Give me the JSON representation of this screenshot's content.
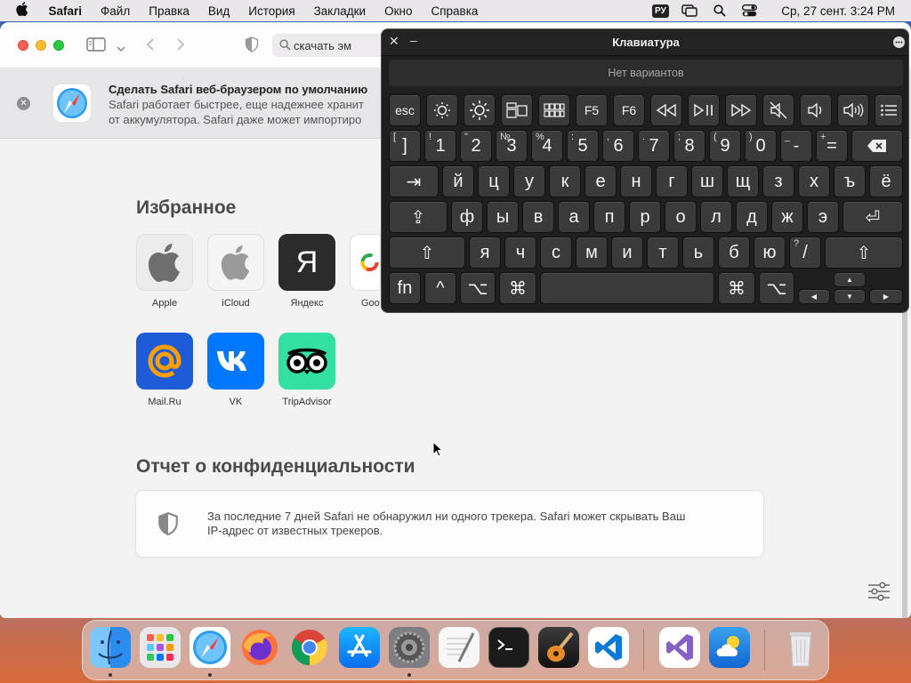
{
  "menubar": {
    "app": "Safari",
    "items": [
      "Файл",
      "Правка",
      "Вид",
      "История",
      "Закладки",
      "Окно",
      "Справка"
    ],
    "input_lang": "РУ",
    "clock": "Ср, 27 сент.  3:24 PM"
  },
  "toolbar": {
    "search_value": "скачать эм"
  },
  "banner": {
    "title": "Сделать Safari веб-браузером по умолчанию",
    "line1": "Safari работает быстрее, еще надежнее хранит",
    "line2": "от аккумулятора. Safari даже может импортиро"
  },
  "favorites": {
    "heading": "Избранное",
    "items": [
      "Apple",
      "iCloud",
      "Яндекс",
      "Goo",
      "Mail.Ru",
      "VK",
      "TripAdvisor"
    ],
    "yandex_glyph": "Я",
    "google_glyph": "G"
  },
  "privacy": {
    "heading": "Отчет о конфиденциальности",
    "line1": "За последние 7 дней Safari не обнаружил ни одного трекера. Safari может скрывать Ваш",
    "line2": "IP-адрес от известных трекеров."
  },
  "keyboard": {
    "title": "Клавиатура",
    "suggestion": "Нет вариантов",
    "fn_row": {
      "esc": "esc",
      "f5": "F5",
      "f6": "F6"
    },
    "num_row": [
      {
        "shift": "[",
        "main": "]"
      },
      {
        "shift": "!",
        "main": "1"
      },
      {
        "shift": "\"",
        "main": "2"
      },
      {
        "shift": "№",
        "main": "3"
      },
      {
        "shift": "%",
        "main": "4"
      },
      {
        "shift": ":",
        "main": "5"
      },
      {
        "shift": ",",
        "main": "6"
      },
      {
        "shift": ".",
        "main": "7"
      },
      {
        "shift": ";",
        "main": "8"
      },
      {
        "shift": "(",
        "main": "9"
      },
      {
        "shift": ")",
        "main": "0"
      },
      {
        "shift": "_",
        "main": "-"
      },
      {
        "shift": "+",
        "main": "="
      }
    ],
    "row1": [
      "й",
      "ц",
      "у",
      "к",
      "е",
      "н",
      "г",
      "ш",
      "щ",
      "з",
      "х",
      "ъ",
      "ё"
    ],
    "row2": [
      "ф",
      "ы",
      "в",
      "а",
      "п",
      "р",
      "о",
      "л",
      "д",
      "ж",
      "э"
    ],
    "row3": [
      "я",
      "ч",
      "с",
      "м",
      "и",
      "т",
      "ь",
      "б",
      "ю"
    ],
    "slash_key": {
      "shift": "?",
      "main": "/"
    },
    "bottom": {
      "fn": "fn",
      "ctrl": "^",
      "option": "⌥",
      "command": "⌘"
    },
    "symbols": {
      "tab": "⇥",
      "capslock": "⇪",
      "shift": "⇧",
      "enter": "⏎",
      "arrow_up": "▲",
      "arrow_down": "▼",
      "arrow_left": "◀",
      "arrow_right": "▶",
      "close": "✕",
      "minimize": "–"
    }
  },
  "colors": {
    "keyboard_bg": "#1f1f1f",
    "key_bg": "#3a3a3a",
    "vk": "#0077ff",
    "mailru": "#1d5cd6",
    "tripadvisor": "#34e0a1",
    "yandex": "#2b2b2b"
  }
}
